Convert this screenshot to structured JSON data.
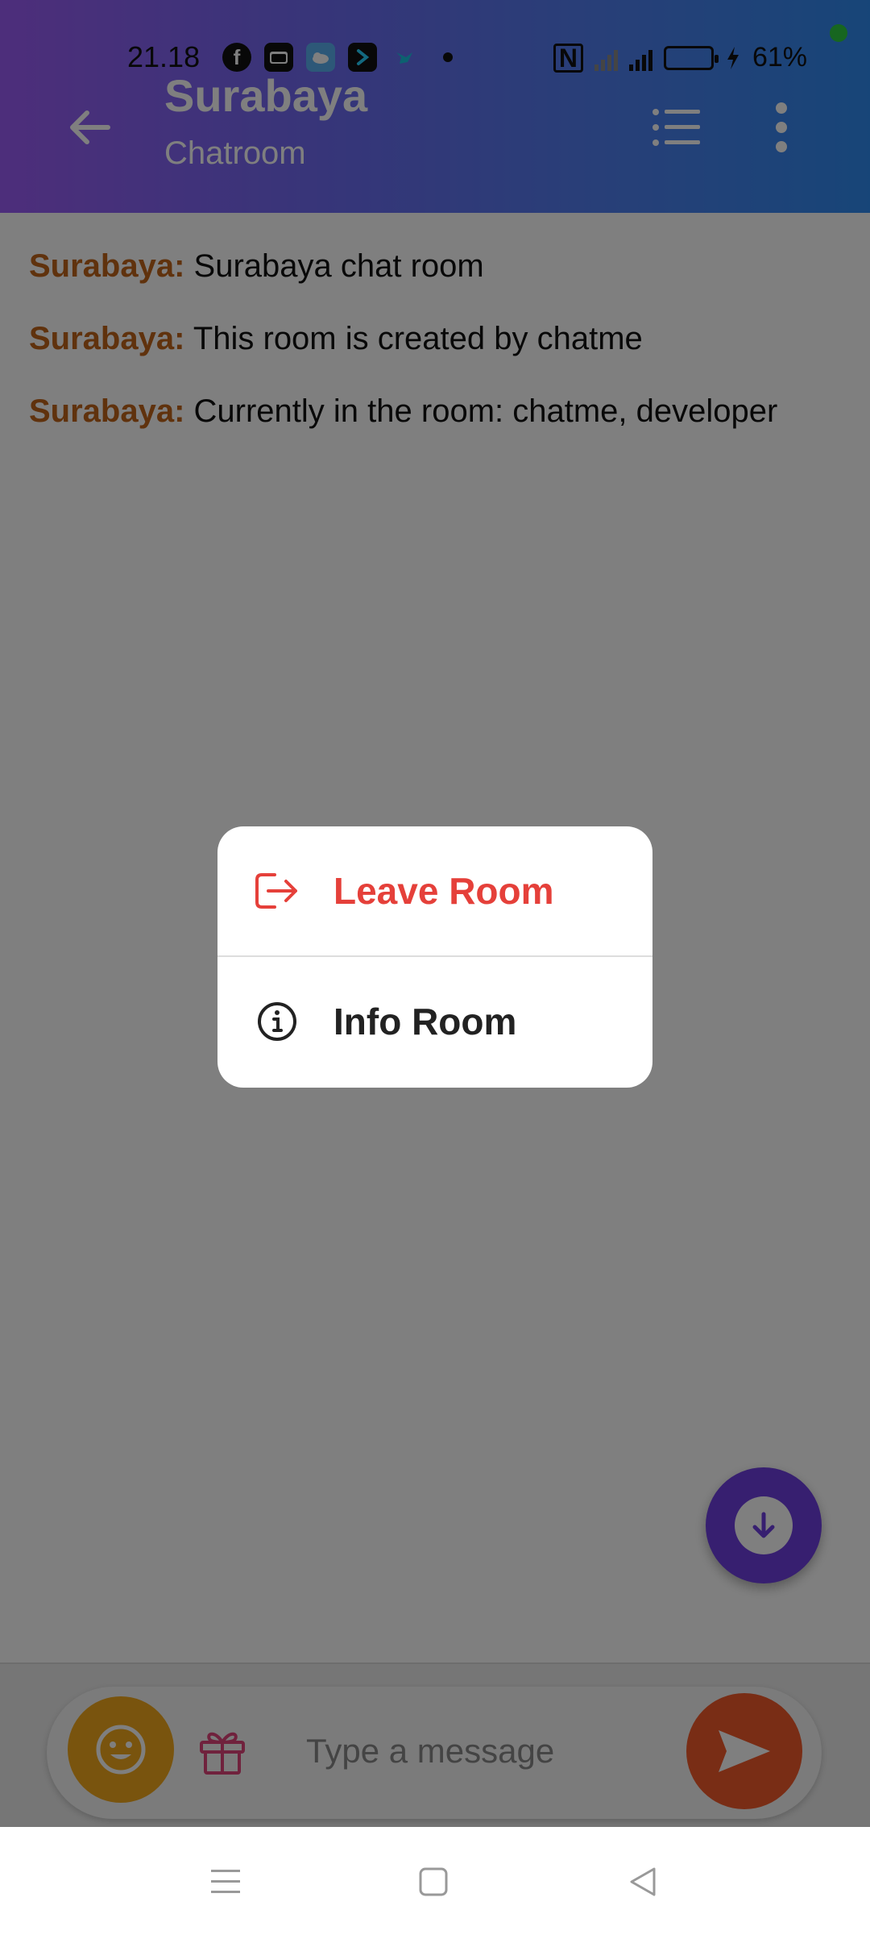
{
  "status_bar": {
    "time": "21.18",
    "battery_percent": "61%",
    "battery_level": 0.61,
    "network": "4G"
  },
  "header": {
    "title": "Surabaya",
    "subtitle": "Chatroom"
  },
  "messages": [
    {
      "sender": "Surabaya:",
      "text": " Surabaya chat room"
    },
    {
      "sender": "Surabaya:",
      "text": " This room is created by chatme"
    },
    {
      "sender": "Surabaya:",
      "text": " Currently in the room: chatme, developer"
    }
  ],
  "input": {
    "placeholder": "Type a message",
    "value": ""
  },
  "popup_menu": {
    "items": [
      {
        "label": "Leave Room",
        "icon": "logout-icon",
        "color": "#e5403a"
      },
      {
        "label": "Info Room",
        "icon": "info-icon",
        "color": "#222222"
      }
    ]
  },
  "colors": {
    "sender": "#c0651a",
    "scroll_fab": "#6f3fe0",
    "emoji_button": "#f2a91c",
    "send_button": "#f25a2b"
  }
}
